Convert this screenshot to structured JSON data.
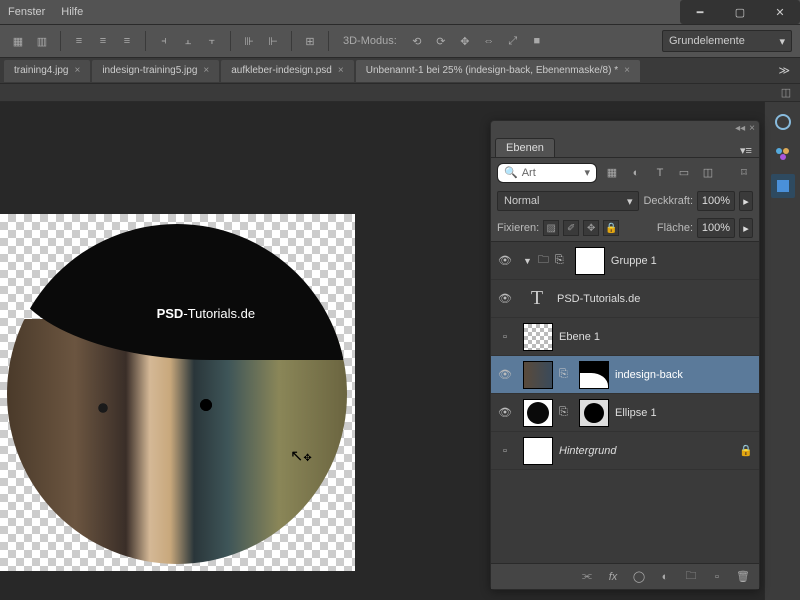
{
  "menu": {
    "fenster": "Fenster",
    "hilfe": "Hilfe"
  },
  "options": {
    "mode_label": "3D-Modus:",
    "workspace_preset": "Grundelemente"
  },
  "tabs": [
    {
      "label": "training4.jpg",
      "active": false
    },
    {
      "label": "indesign-training5.jpg",
      "active": false
    },
    {
      "label": "aufkleber-indesign.psd",
      "active": false
    },
    {
      "label": "Unbenannt-1 bei 25% (indesign-back, Ebenenmaske/8) *",
      "active": true
    }
  ],
  "canvas": {
    "brand_bold": "PSD",
    "brand_rest": "-Tutorials.de"
  },
  "panel": {
    "title": "Ebenen",
    "search_label": "Art",
    "blend_mode": "Normal",
    "opacity_label": "Deckkraft:",
    "opacity_value": "100%",
    "lock_label": "Fixieren:",
    "fill_label": "Fläche:",
    "fill_value": "100%",
    "layers": [
      {
        "name": "Gruppe 1",
        "type": "group"
      },
      {
        "name": "PSD-Tutorials.de",
        "type": "text"
      },
      {
        "name": "Ebene 1",
        "type": "pixel"
      },
      {
        "name": "indesign-back",
        "type": "masked",
        "selected": true
      },
      {
        "name": "Ellipse 1",
        "type": "shape"
      },
      {
        "name": "Hintergrund",
        "type": "bg",
        "locked": true
      }
    ]
  }
}
